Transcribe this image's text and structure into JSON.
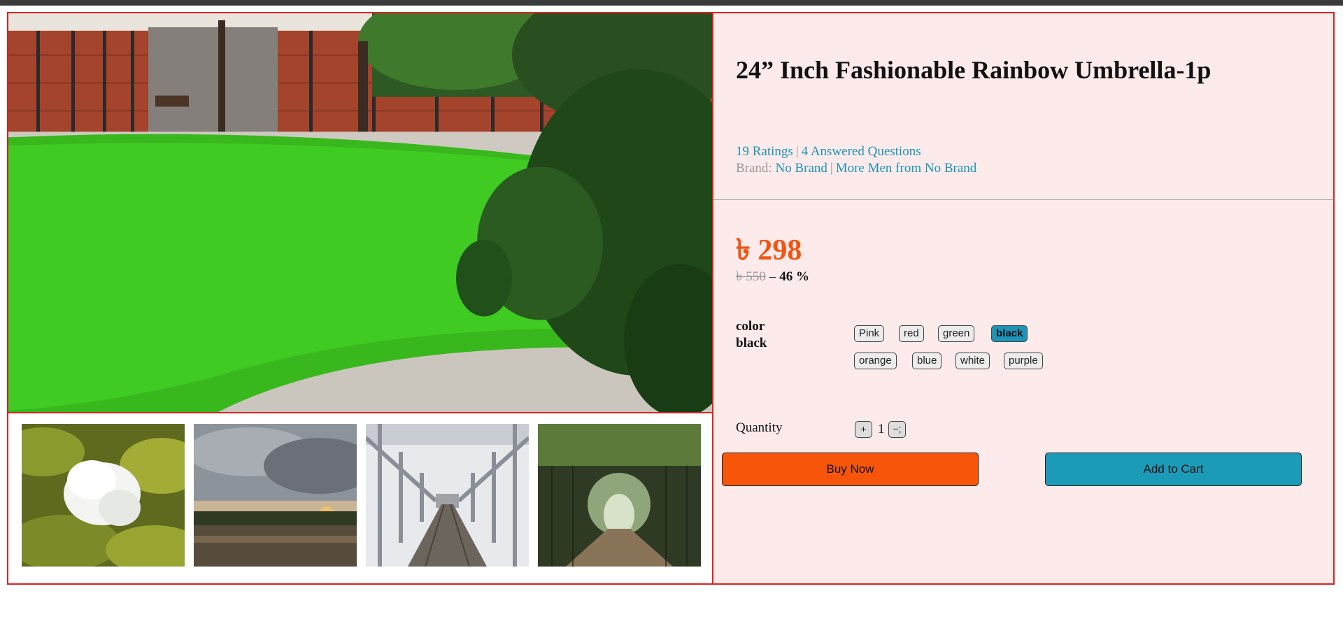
{
  "product": {
    "title": "24” Inch Fashionable Rainbow Umbrella-1p",
    "ratings": "19 Ratings",
    "questions": "4 Answered Questions",
    "brand_label": "Brand:",
    "brand": "No Brand",
    "more_from": "More Men from No Brand",
    "price": "৳ 298",
    "old_price": "৳ 550",
    "price_separator": "–",
    "discount": "46 %"
  },
  "variation": {
    "label": "color",
    "selected": "black",
    "options": [
      "Pink",
      "red",
      "green",
      "black",
      "orange",
      "blue",
      "white",
      "purple"
    ]
  },
  "quantity": {
    "label": "Quantity",
    "value": "1",
    "plus": "+",
    "minus": "−;"
  },
  "actions": {
    "buy_now": "Buy Now",
    "add_to_cart": "Add to Cart"
  },
  "gallery": {
    "main_image": "garden-lawn-photo",
    "thumbnails": [
      "white-flower-photo",
      "river-sunset-photo",
      "railway-bridge-photo",
      "garden-tunnel-photo"
    ]
  },
  "colors": {
    "border": "#e02020",
    "panel_bg": "#fdeaea",
    "price": "#f05511",
    "link": "#1c95b9",
    "buy_now": "#f7560a",
    "add_to_cart": "#1c9bb9"
  }
}
